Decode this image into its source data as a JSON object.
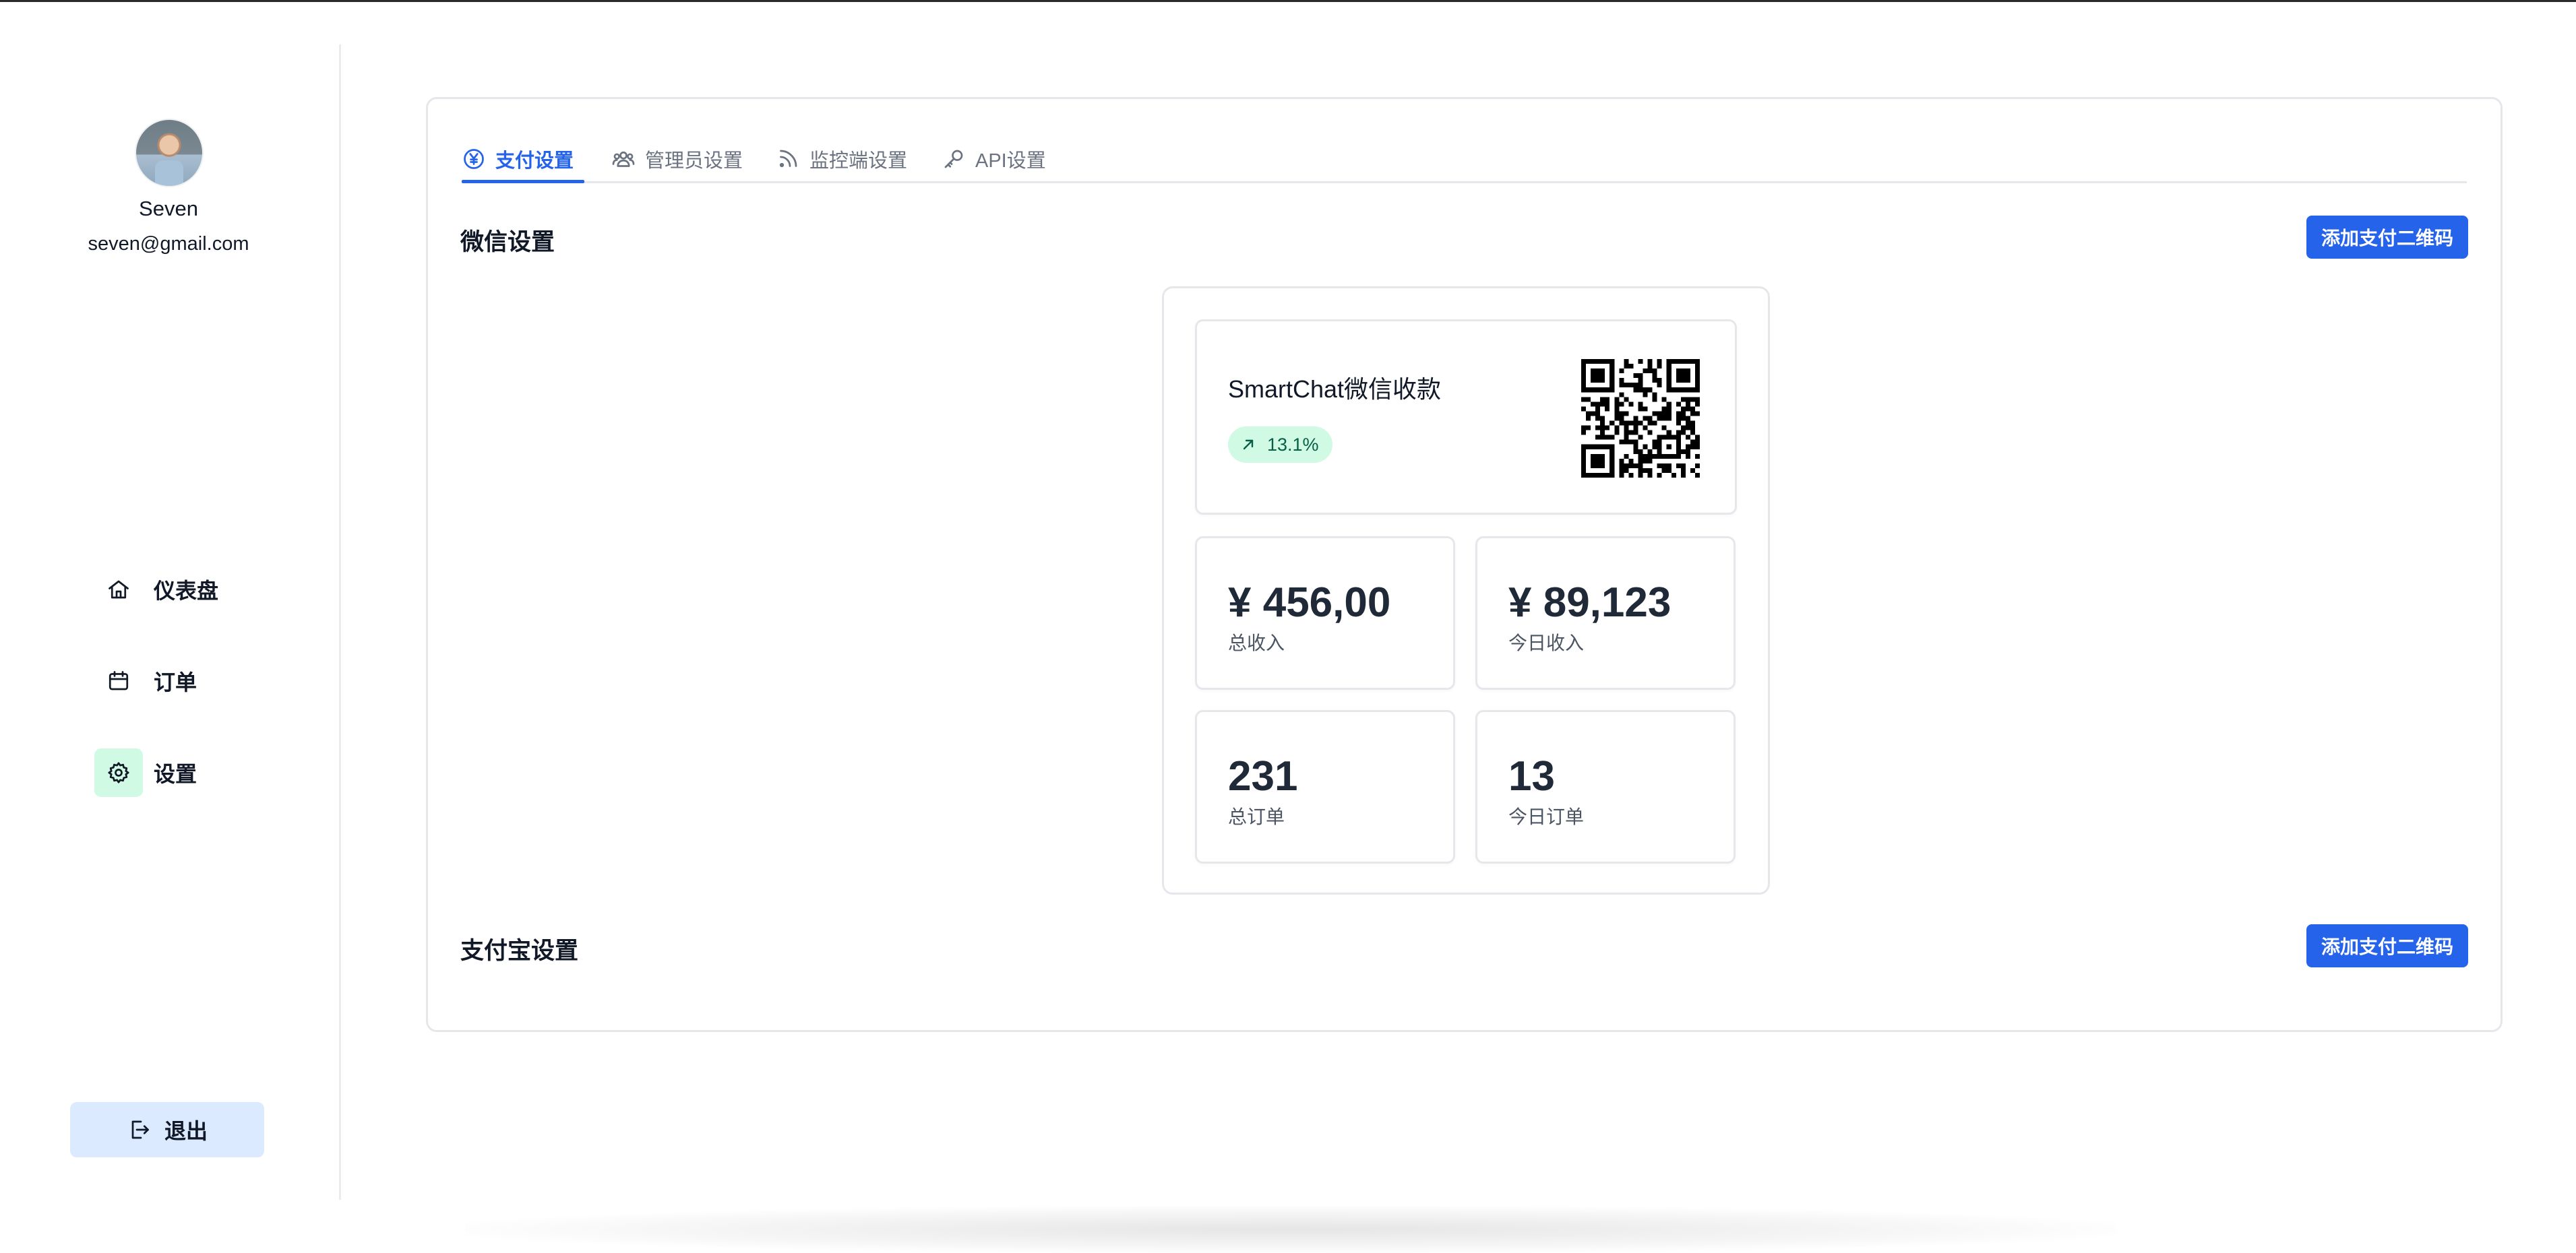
{
  "user": {
    "name": "Seven",
    "email": "seven@gmail.com"
  },
  "nav": {
    "items": [
      {
        "label": "仪表盘",
        "icon": "home-icon"
      },
      {
        "label": "订单",
        "icon": "calendar-icon"
      },
      {
        "label": "设置",
        "icon": "gear-icon",
        "active": true
      }
    ],
    "logout_label": "退出"
  },
  "tabs": [
    {
      "label": "支付设置",
      "icon": "yen-icon",
      "active": true
    },
    {
      "label": "管理员设置",
      "icon": "users-icon"
    },
    {
      "label": "监控端设置",
      "icon": "rss-icon"
    },
    {
      "label": "API设置",
      "icon": "key-icon"
    }
  ],
  "wechat": {
    "title": "微信设置",
    "add_button": "添加支付二维码",
    "card": {
      "title": "SmartChat微信收款",
      "trend": "13.1%",
      "stats": [
        {
          "value": "¥ 456,00",
          "label": "总收入"
        },
        {
          "value": "¥ 89,123",
          "label": "今日收入"
        },
        {
          "value": "231",
          "label": "总订单"
        },
        {
          "value": "13",
          "label": "今日订单"
        }
      ]
    }
  },
  "alipay": {
    "title": "支付宝设置",
    "add_button": "添加支付二维码"
  },
  "colors": {
    "accent": "#2563eb",
    "success_bg": "#d1fae5",
    "logout_bg": "#dbeafe"
  }
}
